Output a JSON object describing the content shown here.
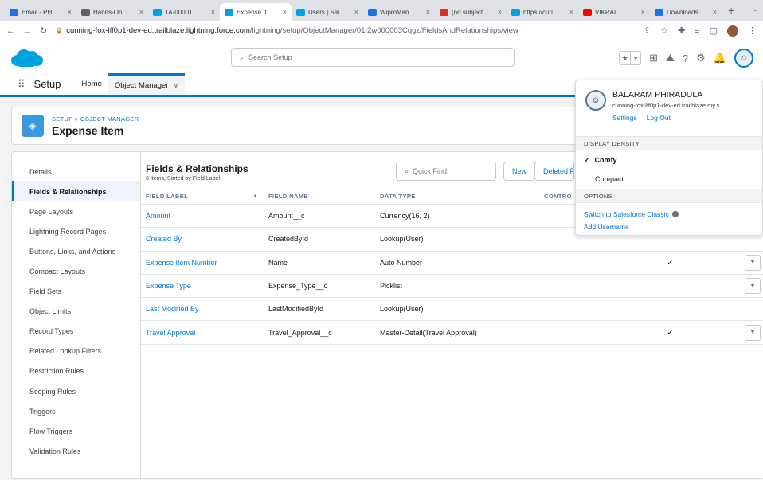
{
  "browser": {
    "tabs": [
      {
        "title": "Email - PH…",
        "color": "#1a73e8"
      },
      {
        "title": "Hands-On",
        "color": "#5f6368"
      },
      {
        "title": "TA-00001",
        "color": "#00a1e0"
      },
      {
        "title": "Expense It",
        "color": "#00a1e0",
        "active": true
      },
      {
        "title": "Users | Sal",
        "color": "#00a1e0"
      },
      {
        "title": "WiproMan",
        "color": "#1a73e8"
      },
      {
        "title": "(no subject",
        "color": "#d93025"
      },
      {
        "title": "https://curi",
        "color": "#00a1e0"
      },
      {
        "title": "VIKRAI",
        "color": "#ff0000"
      },
      {
        "title": "Downloads",
        "color": "#1a73e8"
      }
    ],
    "url_host": "cunning-fox-lff0p1-dev-ed.trailblaze.lightning.force.com",
    "url_path": "/lightning/setup/ObjectManager/01I2w000003Cqgz/FieldsAndRelationships/view"
  },
  "header": {
    "search_placeholder": "Search Setup"
  },
  "setup_nav": {
    "title": "Setup",
    "home": "Home",
    "object_manager": "Object Manager"
  },
  "page_header": {
    "breadcrumb": "SETUP > OBJECT MANAGER",
    "title": "Expense Item"
  },
  "left_nav": {
    "items": [
      "Details",
      "Fields & Relationships",
      "Page Layouts",
      "Lightning Record Pages",
      "Buttons, Links, and Actions",
      "Compact Layouts",
      "Field Sets",
      "Object Limits",
      "Record Types",
      "Related Lookup Filters",
      "Restriction Rules",
      "Scoping Rules",
      "Triggers",
      "Flow Triggers",
      "Validation Rules"
    ]
  },
  "fields": {
    "title": "Fields & Relationships",
    "subtitle": "6 Items, Sorted by Field Label",
    "quick_find_placeholder": "Quick Find",
    "new_button": "New",
    "deleted_button": "Deleted Fi",
    "columns": {
      "label": "FIELD LABEL",
      "name": "FIELD NAME",
      "type": "DATA TYPE",
      "controlling": "CONTRO"
    },
    "sort_indicator": "▲",
    "rows": [
      {
        "label": "Amount",
        "name": "Amount__c",
        "type": "Currency(16, 2)",
        "check": "",
        "dropdown": false
      },
      {
        "label": "Created By",
        "name": "CreatedById",
        "type": "Lookup(User)",
        "check": "",
        "dropdown": false
      },
      {
        "label": "Expense Item Number",
        "name": "Name",
        "type": "Auto Number",
        "check": "✓",
        "dropdown": true
      },
      {
        "label": "Expense Type",
        "name": "Expense_Type__c",
        "type": "Picklist",
        "check": "",
        "dropdown": true
      },
      {
        "label": "Last Modified By",
        "name": "LastModifiedById",
        "type": "Lookup(User)",
        "check": "",
        "dropdown": false
      },
      {
        "label": "Travel Approval",
        "name": "Travel_Approval__c",
        "type": "Master-Detail(Travel Approval)",
        "check": "✓",
        "dropdown": true
      }
    ]
  },
  "user_panel": {
    "name": "BALARAM PHIRADULA",
    "org": "cunning-fox-lff0p1-dev-ed.trailblaze.my.s…",
    "settings": "Settings",
    "logout": "Log Out",
    "density_heading": "DISPLAY DENSITY",
    "density_options": [
      "Comfy",
      "Compact"
    ],
    "selected_density": "Comfy",
    "options_heading": "OPTIONS",
    "switch_classic": "Switch to Salesforce Classic",
    "add_username": "Add Username"
  },
  "colors": {
    "brand_blue": "#0176d3",
    "salesforce_cloud": "#00a1e0"
  }
}
